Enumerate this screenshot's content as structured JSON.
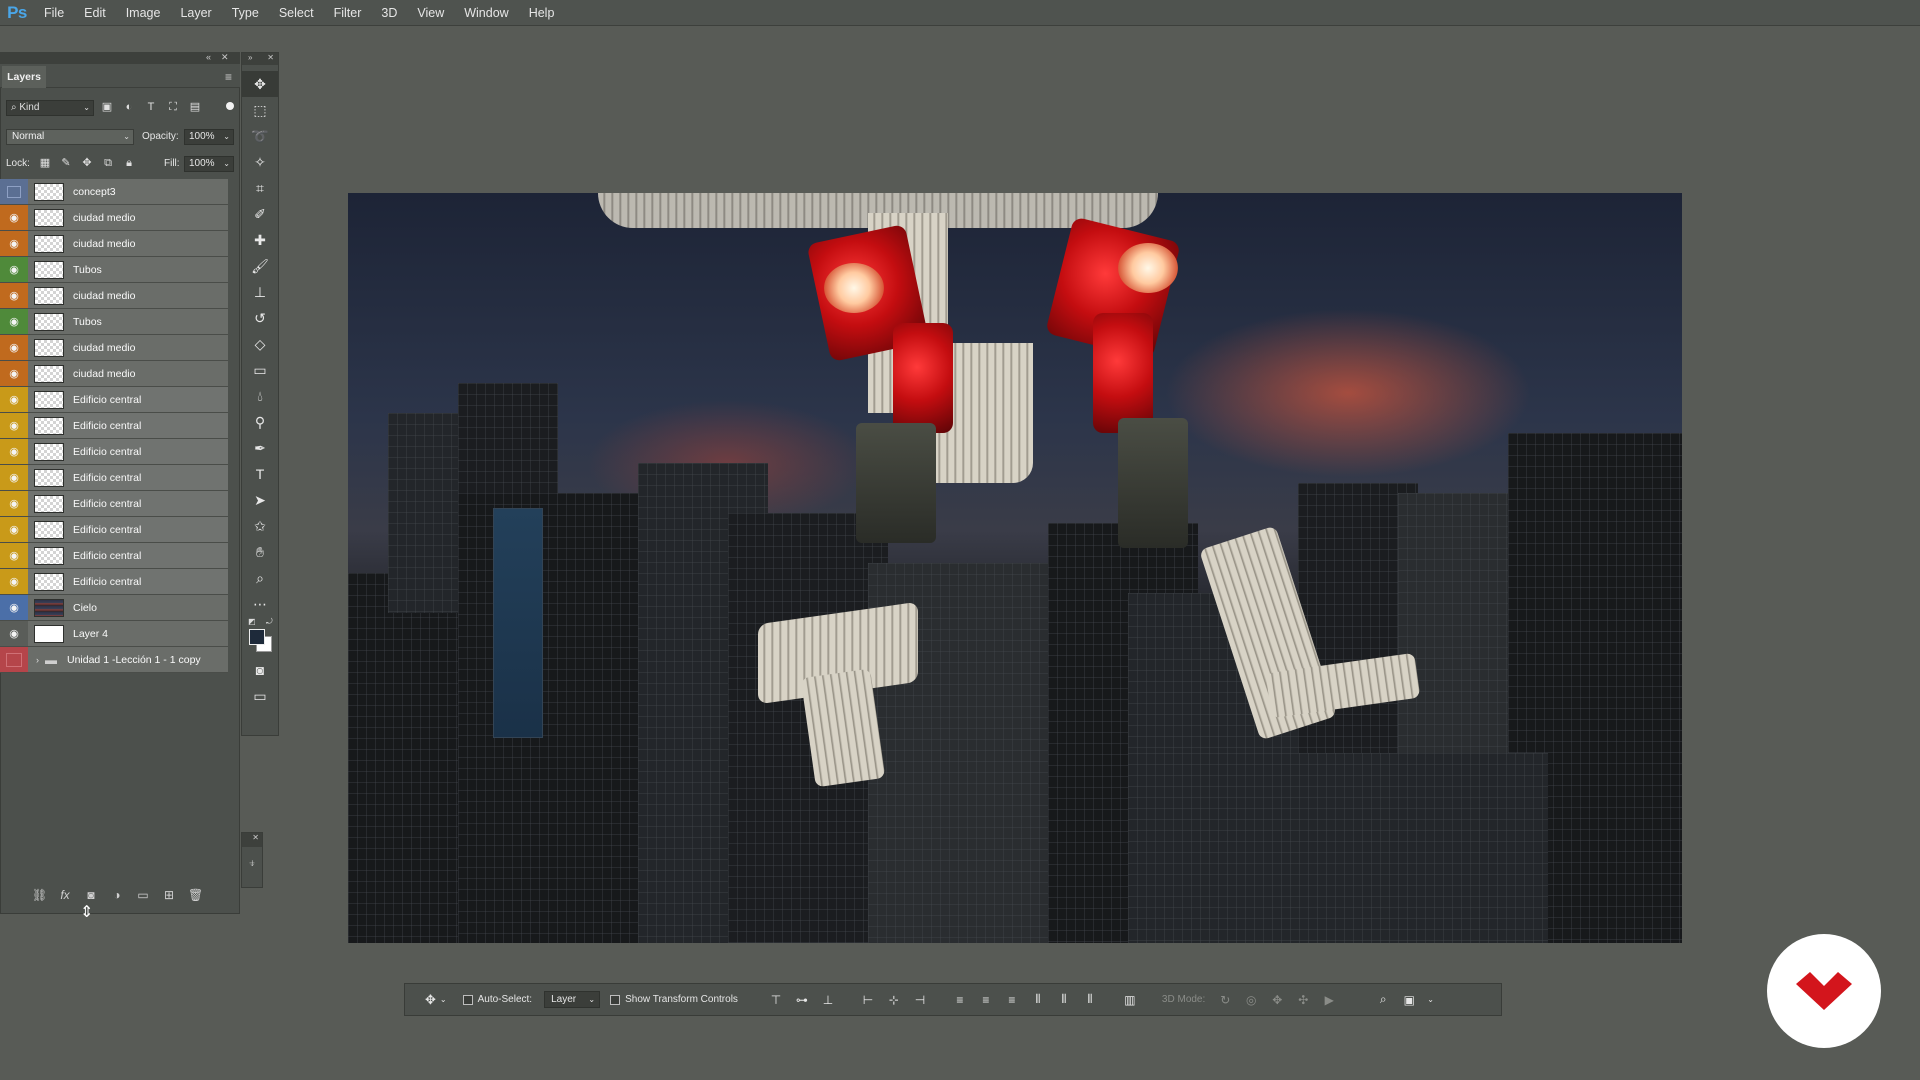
{
  "app": {
    "logo": "Ps"
  },
  "menu": [
    "File",
    "Edit",
    "Image",
    "Layer",
    "Type",
    "Select",
    "Filter",
    "3D",
    "View",
    "Window",
    "Help"
  ],
  "layers_panel": {
    "tab": "Layers",
    "filter_kind": "Kind",
    "blend_mode": "Normal",
    "opacity_label": "Opacity:",
    "opacity": "100%",
    "lock_label": "Lock:",
    "fill_label": "Fill:",
    "fill": "100%",
    "layers": [
      {
        "name": "concept3",
        "visible": false,
        "color": "#5b6f93"
      },
      {
        "name": "ciudad medio",
        "visible": true,
        "color": "#c06a1e"
      },
      {
        "name": "ciudad medio",
        "visible": true,
        "color": "#c06a1e"
      },
      {
        "name": "Tubos",
        "visible": true,
        "color": "#4f8a3a"
      },
      {
        "name": "ciudad medio",
        "visible": true,
        "color": "#c06a1e"
      },
      {
        "name": "Tubos",
        "visible": true,
        "color": "#4f8a3a"
      },
      {
        "name": "ciudad medio",
        "visible": true,
        "color": "#c06a1e"
      },
      {
        "name": "ciudad medio",
        "visible": true,
        "color": "#c06a1e"
      },
      {
        "name": "Edificio central",
        "visible": true,
        "color": "#c99a19"
      },
      {
        "name": "Edificio central",
        "visible": true,
        "color": "#c99a19"
      },
      {
        "name": "Edificio central",
        "visible": true,
        "color": "#c99a19"
      },
      {
        "name": "Edificio central",
        "visible": true,
        "color": "#c99a19"
      },
      {
        "name": "Edificio central",
        "visible": true,
        "color": "#c99a19"
      },
      {
        "name": "Edificio central",
        "visible": true,
        "color": "#c99a19"
      },
      {
        "name": "Edificio central",
        "visible": true,
        "color": "#c99a19"
      },
      {
        "name": "Edificio central",
        "visible": true,
        "color": "#c99a19"
      },
      {
        "name": "Cielo",
        "visible": true,
        "color": "#4b6fa8"
      },
      {
        "name": "Layer 4",
        "visible": true,
        "color": ""
      },
      {
        "name": "Unidad 1 -Lección 1 - 1 copy",
        "visible": false,
        "color": "#b5454a",
        "group": true
      }
    ]
  },
  "options_bar": {
    "auto_select_label": "Auto-Select:",
    "auto_select_value": "Layer",
    "show_transform_label": "Show Transform Controls",
    "mode_3d_label": "3D Mode:"
  },
  "colors": {
    "foreground": "#1e2a3a",
    "background": "#ffffff",
    "brand_red": "#d3151c"
  }
}
